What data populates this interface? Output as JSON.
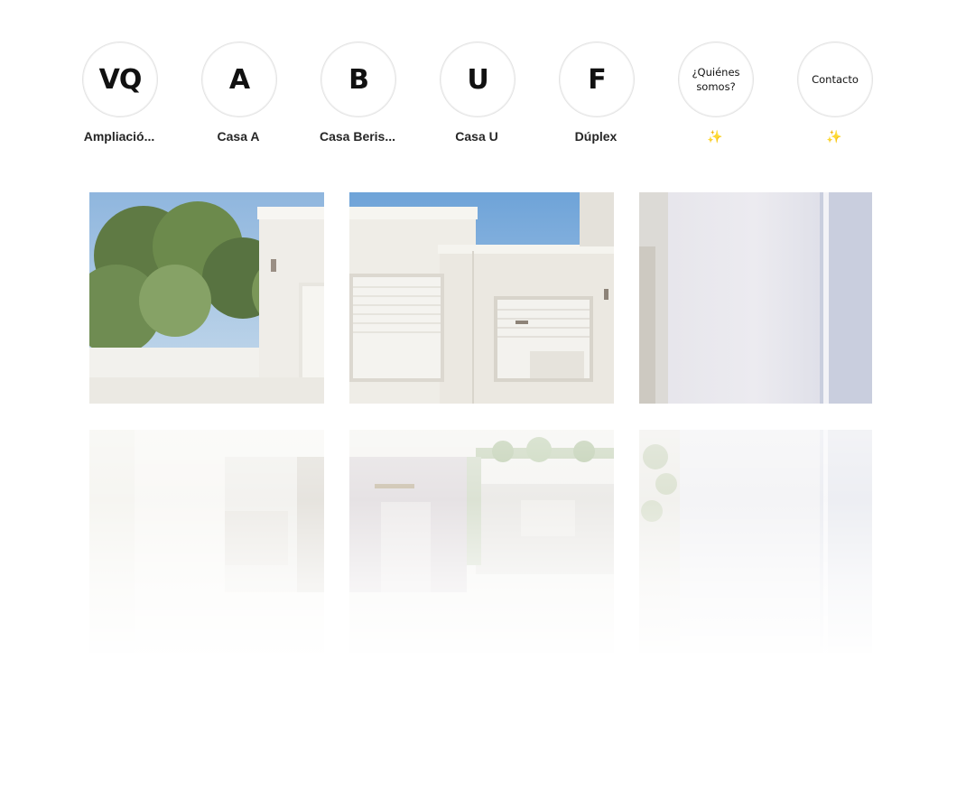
{
  "highlights": [
    {
      "glyph": "VQ",
      "label": "Ampliació..."
    },
    {
      "glyph": "A",
      "label": "Casa A"
    },
    {
      "glyph": "B",
      "label": "Casa Beris..."
    },
    {
      "glyph": "U",
      "label": "Casa U"
    },
    {
      "glyph": "F",
      "label": "Dúplex"
    },
    {
      "glyph": "¿Quiénes somos?",
      "label": "✨"
    },
    {
      "glyph": "Contacto",
      "label": "✨"
    }
  ],
  "posts": [
    {
      "name": "post-1"
    },
    {
      "name": "post-2"
    },
    {
      "name": "post-3"
    },
    {
      "name": "post-4"
    },
    {
      "name": "post-5"
    },
    {
      "name": "post-6"
    }
  ]
}
